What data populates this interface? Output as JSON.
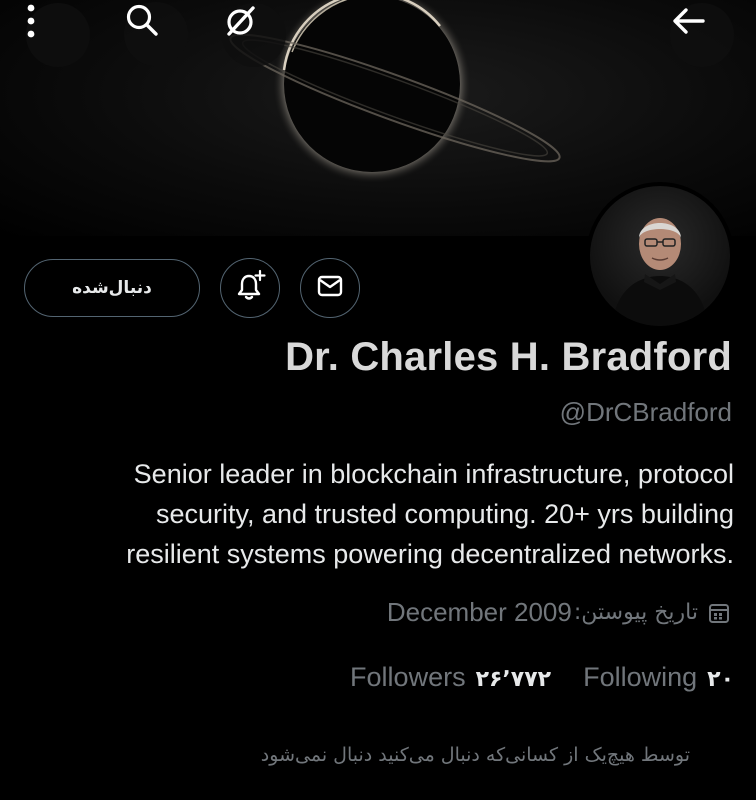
{
  "header": {
    "icons": {
      "more": "more-vertical-icon",
      "search": "search-icon",
      "mute": "no-entry-icon",
      "back": "arrow-back-icon"
    }
  },
  "profile": {
    "name": "Dr. Charles H. Bradford",
    "handle": "@DrCBradford",
    "bio_lines": [
      "Senior leader in blockchain infrastructure, protocol",
      "security, and trusted computing. 20+ yrs building",
      "resilient systems powering decentralized networks."
    ],
    "joined_label": "تاریخ پیوستن:",
    "joined_date": "December 2009",
    "following_count": "۲۰",
    "following_label": "Following",
    "followers_count": "۲۶٬۷۷۲",
    "followers_label": "Followers",
    "not_followed_note": "توسط هیچ‌یک از کسانی‌که دنبال می‌کنید دنبال نمی‌شود"
  },
  "actions": {
    "follow_state_label": "دنبال‌شده",
    "notify_icon": "bell-plus-icon",
    "message_icon": "mail-icon"
  },
  "colors": {
    "background": "#000000",
    "text_primary": "#e7e9ea",
    "text_secondary": "#71767b",
    "border": "#536471"
  }
}
